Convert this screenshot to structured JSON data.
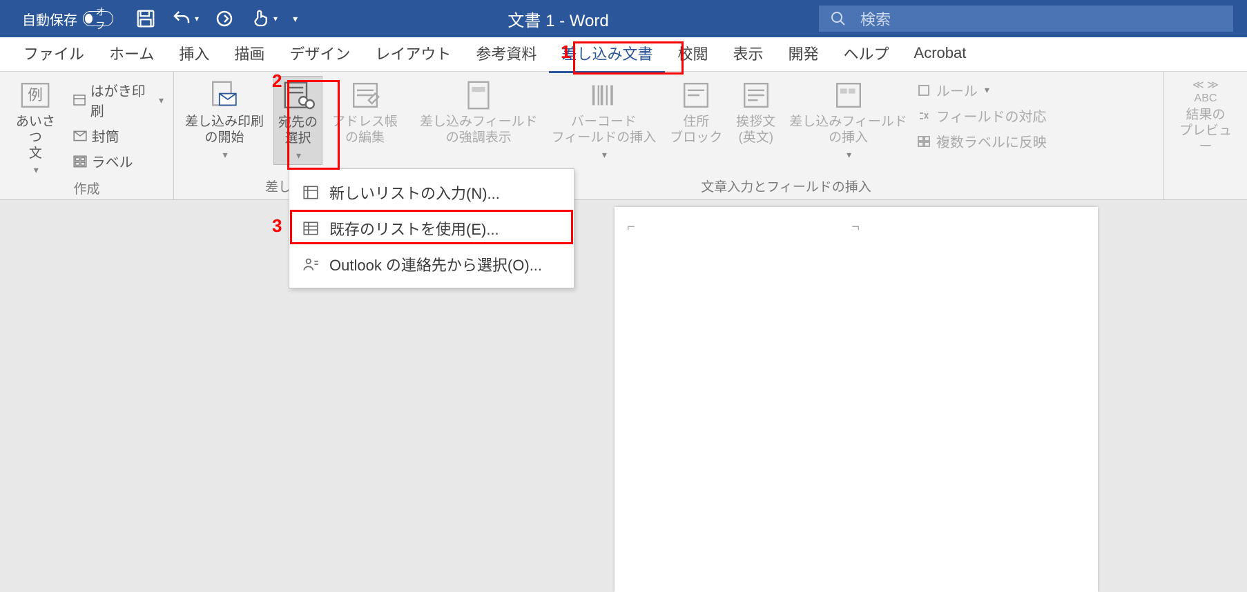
{
  "titlebar": {
    "autosave_label": "自動保存",
    "autosave_state": "オフ",
    "doc_title": "文書 1  -  Word",
    "search_placeholder": "検索"
  },
  "tabs": [
    "ファイル",
    "ホーム",
    "挿入",
    "描画",
    "デザイン",
    "レイアウト",
    "参考資料",
    "差し込み文書",
    "校閲",
    "表示",
    "開発",
    "ヘルプ",
    "Acrobat"
  ],
  "active_tab_index": 7,
  "ribbon": {
    "group_create": {
      "label": "作成",
      "greeting": "あいさつ\n文",
      "postcard": "はがき印刷",
      "envelope": "封筒",
      "label_btn": "ラベル"
    },
    "group_merge": {
      "label": "差し込み",
      "start": "差し込み印刷\nの開始",
      "recipients": "宛先の\n選択",
      "address_book": "アドレス帳\nの編集"
    },
    "group_fields": {
      "label": "文章入力とフィールドの挿入",
      "highlight": "差し込みフィールド\nの強調表示",
      "barcode": "バーコード\nフィールドの挿入",
      "address_block": "住所\nブロック",
      "greeting_line": "挨拶文\n(英文)",
      "insert_field": "差し込みフィールド\nの挿入",
      "rules": "ルール",
      "match": "フィールドの対応",
      "update_labels": "複数ラベルに反映"
    },
    "group_preview": {
      "label": "",
      "preview": "結果の\nプレビュー",
      "nav": "≪ ≫\nABC"
    }
  },
  "dropdown": {
    "new_list": "新しいリストの入力(N)...",
    "existing": "既存のリストを使用(E)...",
    "outlook": "Outlook の連絡先から選択(O)..."
  },
  "annotations": {
    "a1": "1",
    "a2": "2",
    "a3": "3"
  }
}
